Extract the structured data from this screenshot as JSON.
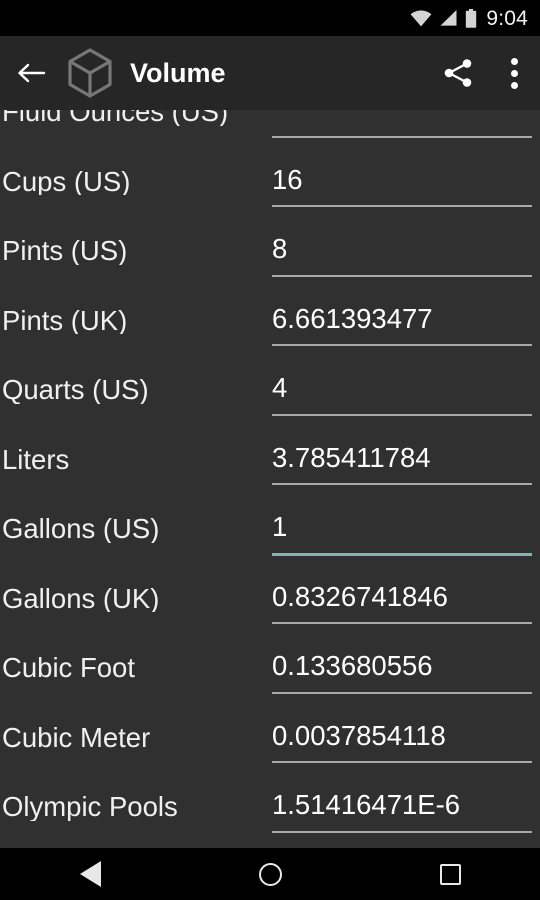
{
  "status_bar": {
    "time": "9:04",
    "icons": [
      "wifi-icon",
      "cell-signal-icon",
      "battery-icon"
    ]
  },
  "toolbar": {
    "back_label": "←",
    "logo": "cube-icon",
    "title": "Volume",
    "share_label": "share-icon",
    "overflow_label": "more-options-icon"
  },
  "conversion_list": {
    "rows": [
      {
        "label": "Fluid Ounces (US)",
        "value": "",
        "focused": false
      },
      {
        "label": "Cups (US)",
        "value": "16",
        "focused": false
      },
      {
        "label": "Pints (US)",
        "value": "8",
        "focused": false
      },
      {
        "label": "Pints (UK)",
        "value": "6.661393477",
        "focused": false
      },
      {
        "label": "Quarts (US)",
        "value": "4",
        "focused": false
      },
      {
        "label": "Liters",
        "value": "3.785411784",
        "focused": false
      },
      {
        "label": "Gallons (US)",
        "value": "1",
        "focused": true
      },
      {
        "label": "Gallons (UK)",
        "value": "0.8326741846",
        "focused": false
      },
      {
        "label": "Cubic Foot",
        "value": "0.133680556",
        "focused": false
      },
      {
        "label": "Cubic Meter",
        "value": "0.0037854118",
        "focused": false
      },
      {
        "label": "Olympic Pools",
        "value": "1.51416471E-6",
        "focused": false
      }
    ]
  },
  "nav_bar": {
    "back": "back-triangle-icon",
    "home": "home-circle-icon",
    "recents": "recents-square-icon"
  },
  "colors": {
    "background": "#303030",
    "toolbar_bg": "#262626",
    "accent": "#7eb5b5",
    "underline": "#a8a8a8",
    "text": "#ffffff"
  }
}
